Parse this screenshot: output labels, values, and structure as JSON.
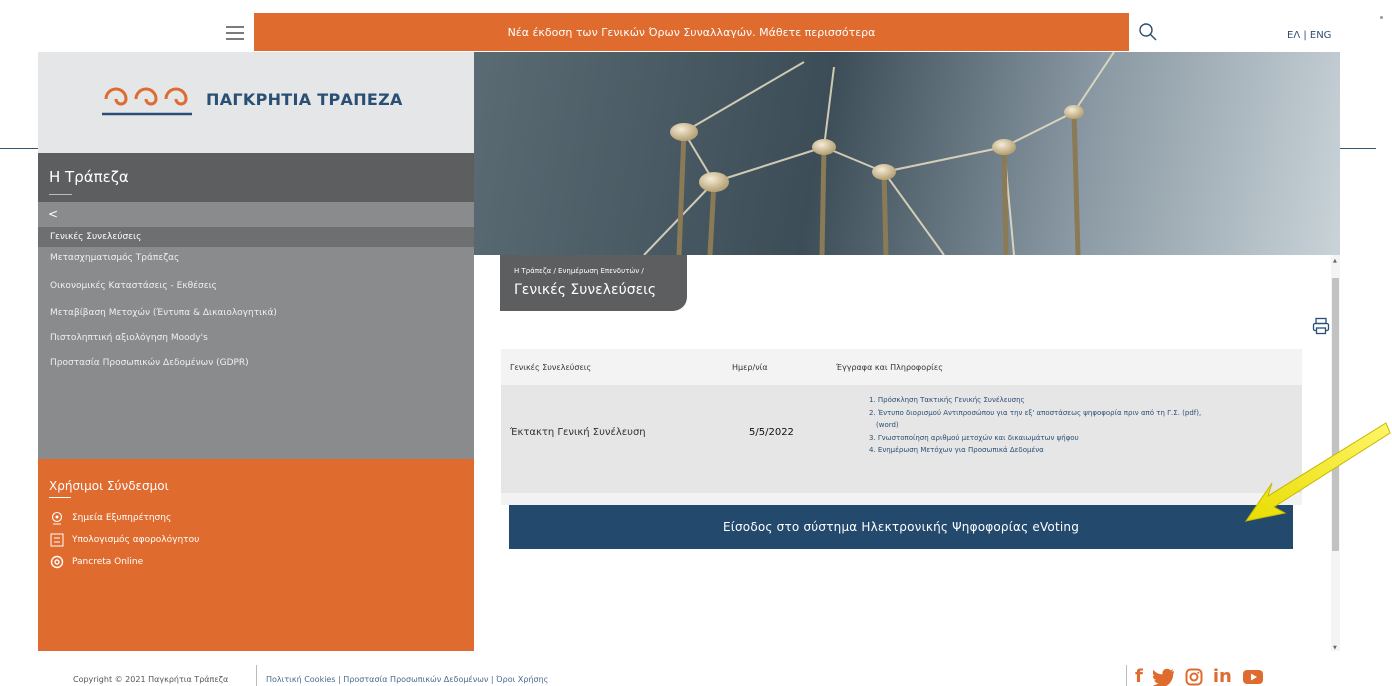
{
  "header": {
    "announcement": "Νέα έκδοση των Γενικών Όρων Συναλλαγών. Μάθετε περισσότερα",
    "lang": "ΕΛ | ENG",
    "hamburger_icon": "hamburger-icon",
    "search_icon": "search-icon"
  },
  "brand": {
    "name": "ΠΑΓΚΡΗΤΙΑ ΤΡΑΠΕΖΑ",
    "logo_color": "#e06b2f",
    "text_color": "#2a4f74"
  },
  "sidebar": {
    "title": "Η Τράπεζα",
    "back": "<",
    "items": [
      {
        "label": "Γενικές Συνελεύσεις",
        "active": true
      },
      {
        "label": "Μετασχηματισμός Τράπεζας"
      },
      {
        "label": "Οικονομικές Καταστάσεις - Εκθέσεις"
      },
      {
        "label": "Μεταβίβαση Μετοχών (Έντυπα & Δικαιολογητικά)"
      },
      {
        "label": "Πιστοληπτική αξιολόγηση Moody's"
      },
      {
        "label": "Προστασία Προσωπικών Δεδομένων (GDPR)"
      }
    ],
    "useful_title": "Χρήσιμοι Σύνδεσμοι",
    "useful_links": [
      {
        "label": "Σημεία Εξυπηρέτησης",
        "icon": "location-pin-icon"
      },
      {
        "label": "Υπολογισμός αφορολόγητου",
        "icon": "calculator-icon"
      },
      {
        "label": "Pancreta Online",
        "icon": "at-sign-icon"
      }
    ]
  },
  "content": {
    "breadcrumb": "Η Τράπεζα / Ενημέρωση Επενδυτών /",
    "title": "Γενικές Συνελεύσεις",
    "print_icon": "printer-icon",
    "table": {
      "headers": [
        "Γενικές Συνελεύσεις",
        "Ημερ/νία",
        "Έγγραφα και Πληροφορίες"
      ],
      "rows": [
        {
          "name": "Έκτακτη Γενική Συνέλευση",
          "date": "5/5/2022",
          "docs": [
            "1. Πρόσκληση Τακτικής Γενικής Συνέλευσης",
            "2. Έντυπο διορισμού Αντιπροσώπου για την εξ' αποστάσεως ψηφοφορία πριν από τη Γ.Σ. (pdf),",
            "(word)",
            "3. Γνωστοποίηση αριθμού μετοχών και δικαιωμάτων ψήφου",
            "4. Ενημέρωση Μετόχων για Προσωπικά Δεδομένα"
          ]
        }
      ]
    },
    "evoting": "Είσοδος στο σύστημα Ηλεκτρονικής Ψηφοφορίας eVoting",
    "annotation_arrow_color": "#f2ea00"
  },
  "footer": {
    "copyright": "Copyright © 2021 Παγκρήτια Τράπεζα",
    "links": "Πολιτική Cookies | Προστασία Προσωπικών Δεδομένων | Όροι Χρήσης",
    "social": [
      "facebook-icon",
      "twitter-icon",
      "instagram-icon",
      "linkedin-icon",
      "youtube-icon"
    ]
  }
}
